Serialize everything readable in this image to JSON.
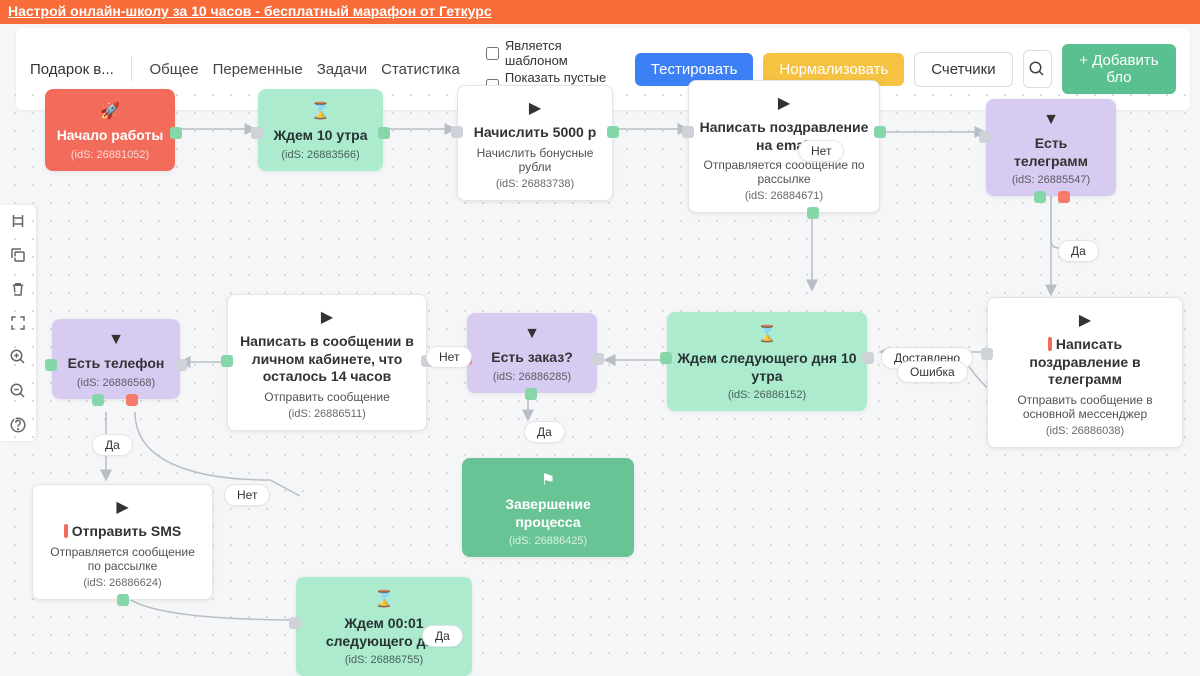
{
  "banner": {
    "text": "Настрой онлайн-школу за 10 часов - бесплатный марафон от Геткурс"
  },
  "toolbar": {
    "title": "Подарок в...",
    "tabs": {
      "general": "Общее",
      "vars": "Переменные",
      "tasks": "Задачи",
      "stats": "Статистика"
    },
    "checks": {
      "template": "Является шаблоном",
      "showEmpty": "Показать пустые выходы"
    },
    "buttons": {
      "test": "Тестировать",
      "normalize": "Нормализовать",
      "counters": "Счетчики",
      "add": "+ Добавить бло"
    }
  },
  "nodes": {
    "start": {
      "title": "Начало работы",
      "ids": "(idS: 26881052)"
    },
    "wait10": {
      "title": "Ждем 10 утра",
      "ids": "(idS: 26883566)"
    },
    "charge": {
      "title": "Начислить 5000 р",
      "sub": "Начислить бонусные рубли",
      "ids": "(idS: 26883738)"
    },
    "emailGreet": {
      "title": "Написать поздравление на email",
      "sub": "Отправляется сообщение по рассылке",
      "ids": "(idS: 26884671)"
    },
    "hasTg": {
      "title": "Есть телеграмм",
      "ids": "(idS: 26885547)"
    },
    "tgGreet": {
      "title": "Написать поздравление в телеграмм",
      "sub": "Отправить сообщение в основной мессенджер",
      "ids": "(idS: 26886038)"
    },
    "waitNext": {
      "title": "Ждем следующего дня 10 утра",
      "ids": "(idS: 26886152)"
    },
    "hasOrder": {
      "title": "Есть заказ?",
      "ids": "(idS: 26886285)"
    },
    "finish": {
      "title": "Завершение процесса",
      "ids": "(idS: 26886425)"
    },
    "write14": {
      "title": "Написать в сообщении в личном кабинете, что осталось 14 часов",
      "sub": "Отправить сообщение",
      "ids": "(idS: 26886511)"
    },
    "hasPhone": {
      "title": "Есть телефон",
      "ids": "(idS: 26886568)"
    },
    "sendSms": {
      "title": "Отправить SMS",
      "sub": "Отправляется сообщение по рассылке",
      "ids": "(idS: 26886624)"
    },
    "wait0001": {
      "title": "Ждем 00:01 следующего дня",
      "ids": "(idS: 26886755)"
    }
  },
  "labels": {
    "no1": "Нет",
    "yes1": "Да",
    "no2": "Нет",
    "yes2": "Да",
    "no3": "Нет",
    "yes3": "Да",
    "yes4": "Да",
    "delivered": "Доставлено",
    "error": "Ошибка"
  }
}
